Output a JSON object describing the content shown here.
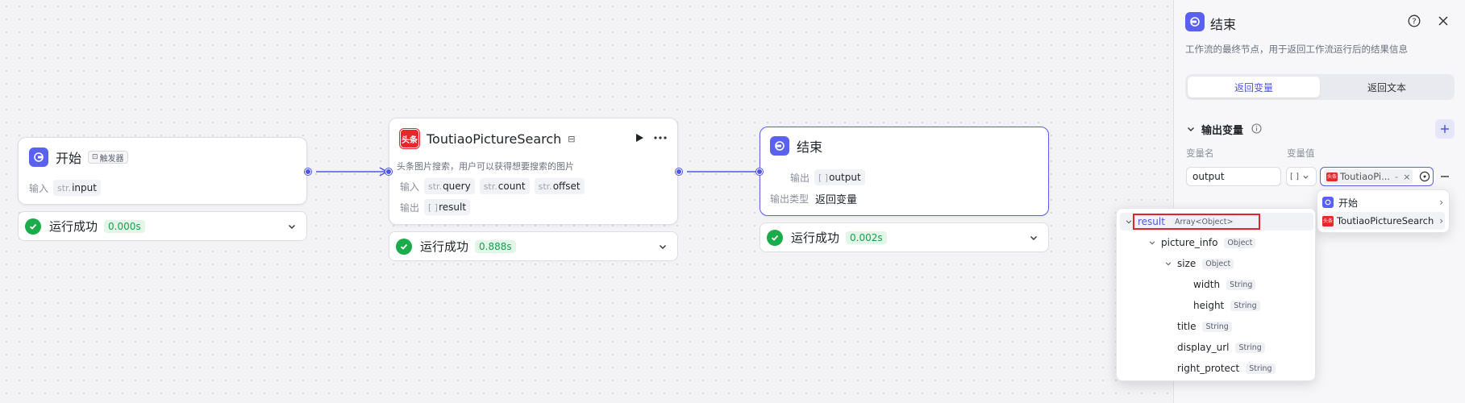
{
  "nodes": {
    "start": {
      "title": "开始",
      "badge": "触发器",
      "input_label": "输入",
      "input_prefix": "str.",
      "input_name": "input",
      "status": "运行成功",
      "time": "0.000s"
    },
    "search": {
      "title": "ToutiaoPictureSearch",
      "icon_text": "头条",
      "description": "头条图片搜索，用户可以获得想要搜索的图片",
      "input_label": "输入",
      "inputs": [
        {
          "prefix": "str.",
          "name": "query"
        },
        {
          "prefix": "str.",
          "name": "count"
        },
        {
          "prefix": "str.",
          "name": "offset"
        }
      ],
      "output_label": "输出",
      "output_prefix": "[ ]",
      "output_name": "result",
      "status": "运行成功",
      "time": "0.888s"
    },
    "end": {
      "title": "结束",
      "output_label": "输出",
      "output_prefix": "[ ]",
      "output_name": "output",
      "output_type_label": "输出类型",
      "output_type_value": "返回变量",
      "status": "运行成功",
      "time": "0.002s"
    }
  },
  "panel": {
    "title": "结束",
    "description": "工作流的最终节点，用于返回工作流运行后的结果信息",
    "tabs": [
      "返回变量",
      "返回文本"
    ],
    "section_title": "输出变量",
    "col_name": "变量名",
    "col_value": "变量值",
    "var_name": "output",
    "var_type": "[ ]",
    "var_ref_icon": "头条",
    "var_ref": "ToutiaoPi...",
    "var_ref_sep": "-"
  },
  "node_picker": {
    "items": [
      {
        "label": "开始"
      },
      {
        "label": "ToutiaoPictureSearch",
        "icon_text": "头条"
      }
    ]
  },
  "field_tree": [
    {
      "name": "result",
      "type": "Array<Object>",
      "level": 0,
      "expandable": true,
      "highlight": true
    },
    {
      "name": "picture_info",
      "type": "Object",
      "level": 1,
      "expandable": true
    },
    {
      "name": "size",
      "type": "Object",
      "level": 2,
      "expandable": true
    },
    {
      "name": "width",
      "type": "String",
      "level": 3,
      "expandable": false
    },
    {
      "name": "height",
      "type": "String",
      "level": 3,
      "expandable": false
    },
    {
      "name": "title",
      "type": "String",
      "level": 2,
      "expandable": false
    },
    {
      "name": "display_url",
      "type": "String",
      "level": 2,
      "expandable": false
    },
    {
      "name": "right_protect",
      "type": "String",
      "level": 2,
      "expandable": false
    }
  ],
  "colors": {
    "accent": "#4e55e8",
    "success": "#1cab4a",
    "toutiao_red": "#e9272b",
    "highlight_box": "#e0242a"
  }
}
